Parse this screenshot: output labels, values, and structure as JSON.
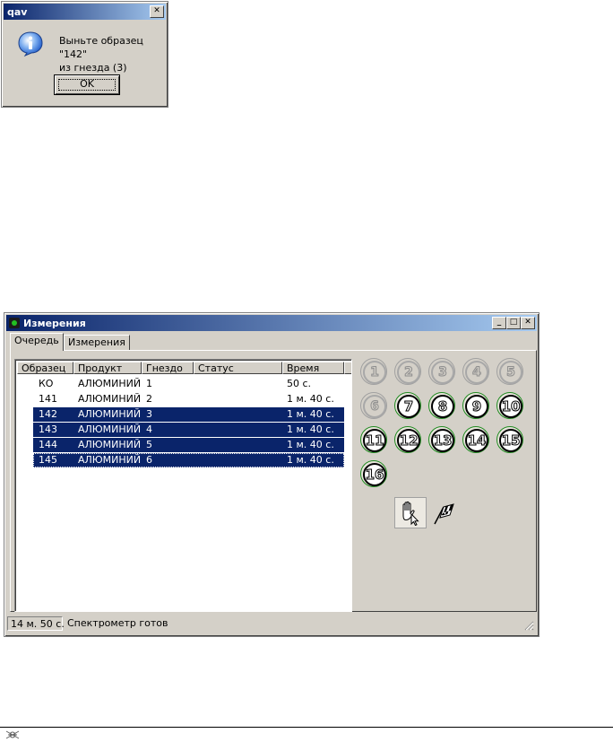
{
  "dialog": {
    "title": "qav",
    "close_glyph": "✕",
    "message_line1": "Выньте образец \"142\"",
    "message_line2": "из гнезда (3)",
    "ok_label": "OK",
    "icon": "info-icon"
  },
  "window": {
    "title": "Измерения",
    "minimize_glyph": "_",
    "maximize_glyph": "□",
    "close_glyph": "✕",
    "tabs": [
      {
        "label": "Очередь",
        "active": true
      },
      {
        "label": "Измерения",
        "active": false
      }
    ],
    "queue": {
      "columns": [
        "Образец",
        "Продукт",
        "Гнездо",
        "Статус",
        "Время"
      ],
      "rows": [
        {
          "sample": "КО",
          "product": "АЛЮМИНИЙ",
          "slot": "1",
          "status": "",
          "time": "50 с.",
          "selected": false
        },
        {
          "sample": "141",
          "product": "АЛЮМИНИЙ",
          "slot": "2",
          "status": "",
          "time": "1 м. 40 с.",
          "selected": false
        },
        {
          "sample": "142",
          "product": "АЛЮМИНИЙ",
          "slot": "3",
          "status": "",
          "time": "1 м. 40 с.",
          "selected": true
        },
        {
          "sample": "143",
          "product": "АЛЮМИНИЙ",
          "slot": "4",
          "status": "",
          "time": "1 м. 40 с.",
          "selected": true
        },
        {
          "sample": "144",
          "product": "АЛЮМИНИЙ",
          "slot": "5",
          "status": "",
          "time": "1 м. 40 с.",
          "selected": true
        },
        {
          "sample": "145",
          "product": "АЛЮМИНИЙ",
          "slot": "6",
          "status": "",
          "time": "1 м. 40 с.",
          "selected": true
        }
      ]
    },
    "slots": [
      {
        "n": "1",
        "filled": false
      },
      {
        "n": "2",
        "filled": false
      },
      {
        "n": "3",
        "filled": false
      },
      {
        "n": "4",
        "filled": false
      },
      {
        "n": "5",
        "filled": false
      },
      {
        "n": "6",
        "filled": false
      },
      {
        "n": "7",
        "filled": true
      },
      {
        "n": "8",
        "filled": true
      },
      {
        "n": "9",
        "filled": true
      },
      {
        "n": "10",
        "filled": true
      },
      {
        "n": "11",
        "filled": true
      },
      {
        "n": "12",
        "filled": true
      },
      {
        "n": "13",
        "filled": true
      },
      {
        "n": "14",
        "filled": true
      },
      {
        "n": "15",
        "filled": true
      },
      {
        "n": "16",
        "filled": true
      }
    ],
    "hand_icon": "hand-icon",
    "flag_icon": "checkered-flag-icon",
    "status": {
      "elapsed": "14 м. 50 с.",
      "message": "Спектрометр готов"
    }
  },
  "colors": {
    "face": "#d4d0c8",
    "titlebar": "#0a246a",
    "selection": "#0a246a",
    "slot_ring_filled": "#1f8a1f"
  }
}
